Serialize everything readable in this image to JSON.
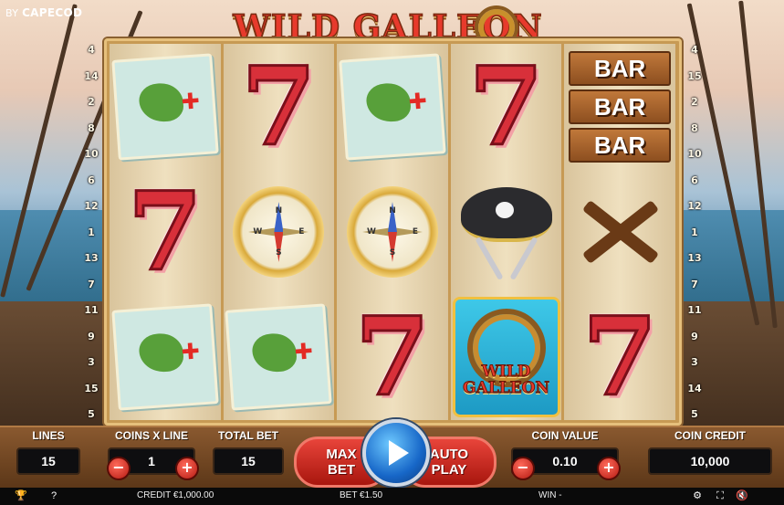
{
  "brand": {
    "prefix": "BY",
    "name": "CAPECOD"
  },
  "logo": {
    "title": "WILD GALLEON"
  },
  "paylines": {
    "left": [
      "4",
      "14",
      "2",
      "8",
      "10",
      "6",
      "12",
      "1",
      "13",
      "7",
      "11",
      "9",
      "3",
      "15",
      "5"
    ],
    "right": [
      "4",
      "15",
      "2",
      "8",
      "10",
      "6",
      "12",
      "1",
      "13",
      "7",
      "11",
      "9",
      "3",
      "14",
      "5"
    ]
  },
  "reels": [
    [
      "map",
      "seven",
      "map"
    ],
    [
      "seven",
      "compass",
      "map"
    ],
    [
      "map",
      "compass",
      "seven"
    ],
    [
      "seven",
      "hat",
      "wild"
    ],
    [
      "bar",
      "pistols",
      "seven"
    ]
  ],
  "symbols": {
    "seven": "7",
    "bar": "BAR",
    "wild_line1": "WILD",
    "wild_line2": "GALLEON",
    "compass_dirs": [
      "N",
      "E",
      "S",
      "W"
    ]
  },
  "controls": {
    "lines": {
      "label": "LINES",
      "value": "15"
    },
    "coins_x_line": {
      "label": "COINS X LINE",
      "value": "1",
      "minus": "−",
      "plus": "+"
    },
    "total_bet": {
      "label": "TOTAL BET",
      "value": "15"
    },
    "max_bet": {
      "line1": "MAX",
      "line2": "BET"
    },
    "auto_play": {
      "line1": "AUTO",
      "line2": "PLAY"
    },
    "coin_value": {
      "label": "COIN VALUE",
      "value": "0.10",
      "minus": "−",
      "plus": "+"
    },
    "coin_credit": {
      "label": "COIN CREDIT",
      "value": "10,000"
    }
  },
  "status": {
    "credit": "CREDIT €1,000.00",
    "bet": "BET €1.50",
    "win": "WIN -"
  },
  "icons": {
    "trophy": "🏆",
    "help": "?",
    "settings": "⚙",
    "fullscreen": "⛶",
    "sound": "🔇"
  },
  "colors": {
    "seven_red": "#d8303a",
    "panel_brown": "#8b5a30",
    "spin_blue": "#1767c8"
  }
}
